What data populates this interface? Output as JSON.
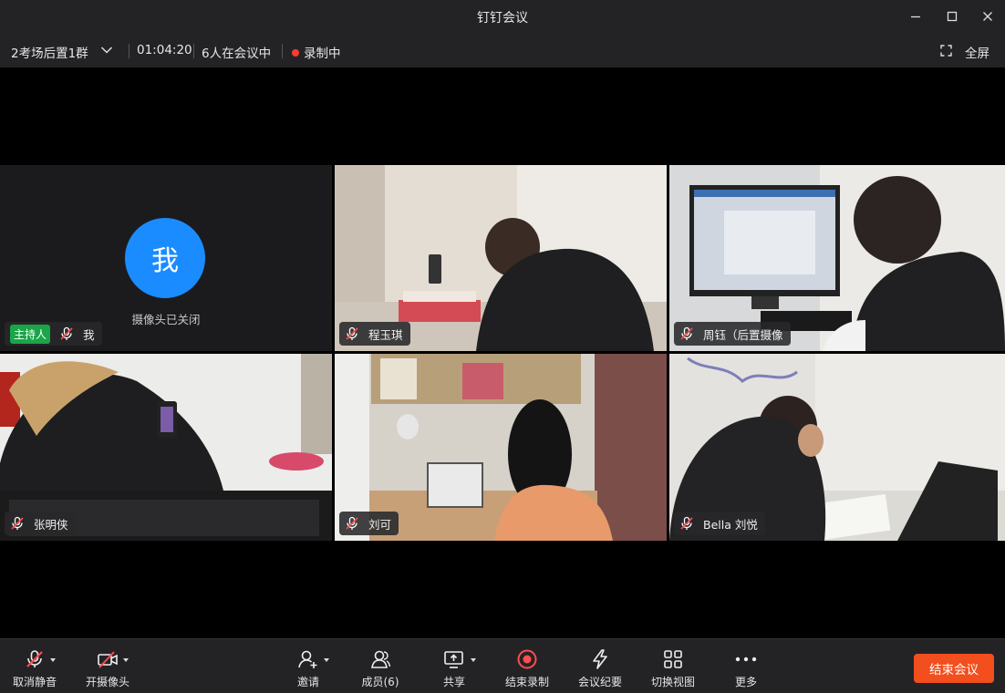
{
  "window": {
    "title": "钉钉会议"
  },
  "infobar": {
    "meeting_name": "2考场后置1群",
    "duration": "01:04:20",
    "participants_status": "6人在会议中",
    "recording_status": "录制中",
    "fullscreen_label": "全屏"
  },
  "tiles": [
    {
      "name": "我",
      "host_badge": "主持人",
      "avatar_text": "我",
      "camera_status": "摄像头已关闭"
    },
    {
      "name": "程玉琪"
    },
    {
      "name": "周钰（后置摄像"
    },
    {
      "name": "张明侠"
    },
    {
      "name": "刘可"
    },
    {
      "name": "Bella 刘悦"
    }
  ],
  "toolbar": {
    "mute": "取消静音",
    "camera": "开摄像头",
    "invite": "邀请",
    "members": "成员(6)",
    "share": "共享",
    "end_recording": "结束录制",
    "minutes": "会议纪要",
    "switch_view": "切换视图",
    "more": "更多",
    "end_meeting": "结束会议"
  },
  "colors": {
    "accent_end": "#f24e1e",
    "host_badge": "#1aa548",
    "avatar": "#1a8cff",
    "recording": "#ff3b30"
  }
}
